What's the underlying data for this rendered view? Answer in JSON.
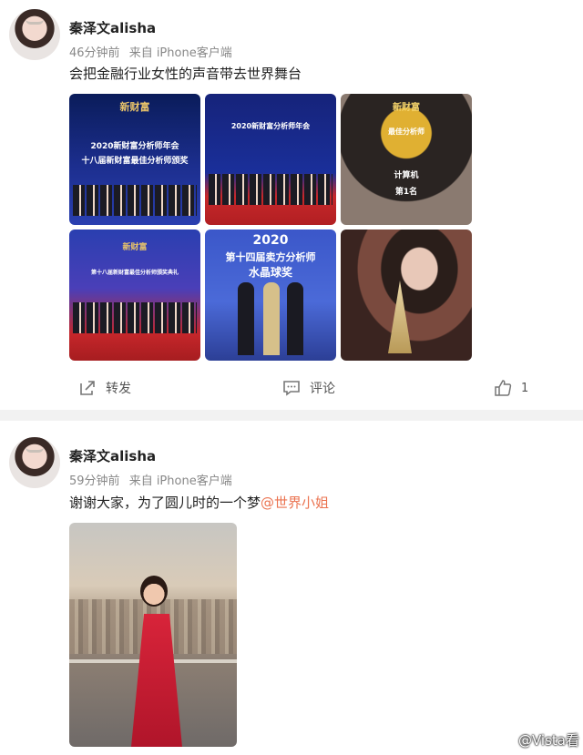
{
  "posts": [
    {
      "author": "秦泽文alisha",
      "time": "46分钟前",
      "source": "来自 iPhone客户端",
      "text": "会把金融行业女性的声音带去世界舞台",
      "images": [
        {
          "caption_lines": [
            "新财富",
            "2020新财富分析师年会",
            "十八届新财富最佳分析师颁奖"
          ]
        },
        {
          "caption_lines": [
            "2020新财富分析师年会"
          ]
        },
        {
          "caption_lines": [
            "新财富",
            "最佳分析师",
            "计算机",
            "第1名"
          ]
        },
        {
          "caption_lines": [
            "新财富",
            "第十八届新财富最佳分析师颁奖典礼"
          ]
        },
        {
          "caption_lines": [
            "2020",
            "第十四届卖方分析师",
            "水晶球奖"
          ]
        },
        {
          "caption_lines": []
        }
      ],
      "actions": {
        "repost": "转发",
        "comment": "评论",
        "like_count": "1"
      }
    },
    {
      "author": "秦泽文alisha",
      "time": "59分钟前",
      "source": "来自 iPhone客户端",
      "text_prefix": "谢谢大家，为了圆儿时的一个梦",
      "mention": "@世界小姐"
    }
  ],
  "watermark": "@Vista看",
  "colors": {
    "mention": "#eb7350",
    "divider": "#f2f2f2"
  }
}
